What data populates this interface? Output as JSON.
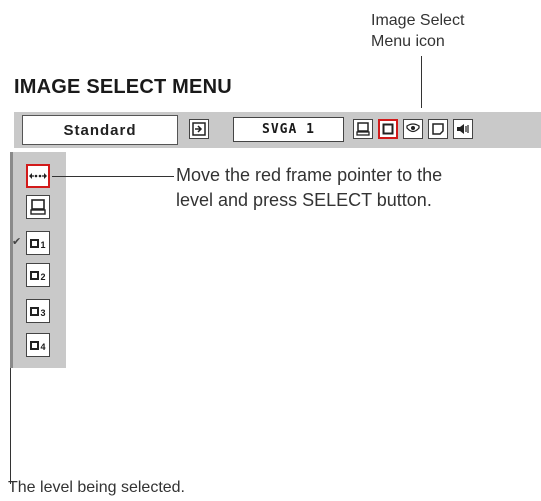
{
  "callouts": {
    "menu_icon_line1": "Image Select",
    "menu_icon_line2": "Menu icon",
    "pointer_line1": "Move the red frame pointer to the",
    "pointer_line2": "level and press SELECT button.",
    "level_selected": "The level being selected."
  },
  "menu": {
    "title": "IMAGE SELECT MENU",
    "mode_label": "Standard",
    "source_label": "SVGA 1",
    "toolbar_icons": [
      "input-icon",
      "computer-icon",
      "image-select-icon",
      "image-adjust-icon",
      "screen-icon",
      "sound-icon"
    ],
    "selected_toolbar_icon": "image-select-icon"
  },
  "levels": {
    "items": [
      {
        "icon": "move-arrows-icon",
        "num": ""
      },
      {
        "icon": "computer-icon",
        "num": ""
      },
      {
        "icon": "image-square-icon",
        "num": "1"
      },
      {
        "icon": "image-square-icon",
        "num": "2"
      },
      {
        "icon": "image-square-icon",
        "num": "3"
      },
      {
        "icon": "image-square-icon",
        "num": "4"
      }
    ],
    "current_level": "1",
    "pointer_item": "move-arrows-icon",
    "check_mark": "✔"
  },
  "colors": {
    "panel_bg": "#c9c9c9",
    "pointer_frame": "#d21a1a"
  }
}
